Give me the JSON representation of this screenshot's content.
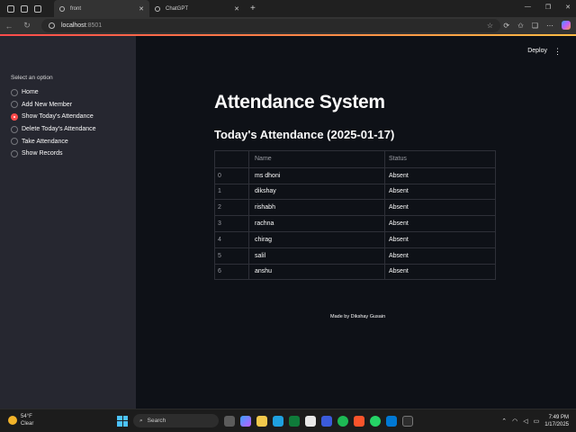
{
  "browser": {
    "tabs": [
      {
        "label": "front",
        "active": true
      },
      {
        "label": "ChatGPT",
        "active": false
      }
    ],
    "url_host": "localhost",
    "url_port": ":8501"
  },
  "sidebar": {
    "label": "Select an option",
    "options": [
      {
        "label": "Home",
        "selected": false
      },
      {
        "label": "Add New Member",
        "selected": false
      },
      {
        "label": "Show Today's Attendance",
        "selected": true
      },
      {
        "label": "Delete Today's Attendance",
        "selected": false
      },
      {
        "label": "Take Attendance",
        "selected": false
      },
      {
        "label": "Show Records",
        "selected": false
      }
    ]
  },
  "header": {
    "deploy_label": "Deploy",
    "menu_icon": "kebab-menu-icon"
  },
  "main": {
    "title": "Attendance System",
    "subtitle": "Today's Attendance (2025-01-17)",
    "table": {
      "columns": [
        "",
        "Name",
        "Status"
      ],
      "rows": [
        [
          "0",
          "ms dhoni",
          "Absent"
        ],
        [
          "1",
          "dikshay",
          "Absent"
        ],
        [
          "2",
          "rishabh",
          "Absent"
        ],
        [
          "3",
          "rachna",
          "Absent"
        ],
        [
          "4",
          "chirag",
          "Absent"
        ],
        [
          "5",
          "salil",
          "Absent"
        ],
        [
          "6",
          "anshu",
          "Absent"
        ]
      ]
    },
    "footer": "Made by Dikshay Gusain"
  },
  "taskbar": {
    "weather_temp": "54°F",
    "weather_desc": "Clear",
    "search_label": "Search",
    "time": "7:49 PM",
    "date": "1/17/2025"
  },
  "colors": {
    "accent": "#ff4b4b",
    "sidebar_bg": "#262730",
    "main_bg": "#0e1117"
  }
}
